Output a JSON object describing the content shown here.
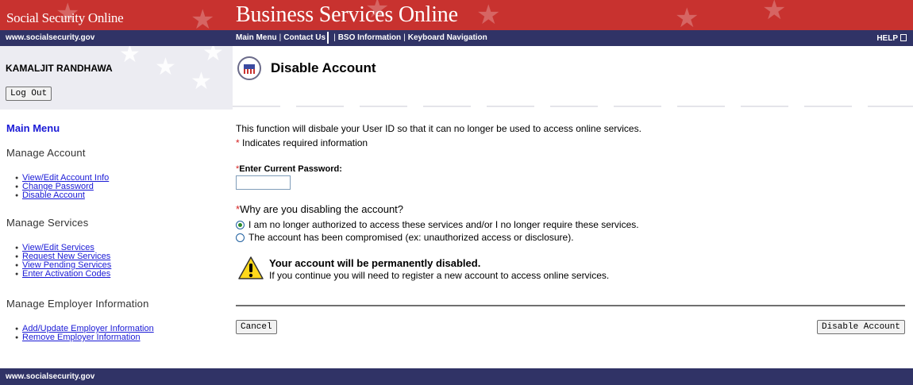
{
  "banner": {
    "site_name": "Social Security Online",
    "app_title": "Business Services Online"
  },
  "navbar": {
    "site_url": "www.socialsecurity.gov",
    "links": {
      "main_menu": "Main Menu",
      "contact_us": "Contact Us",
      "bso_information": "BSO Information",
      "keyboard_navigation": "Keyboard Navigation"
    },
    "separator": "|",
    "help": "HELP"
  },
  "user": {
    "name": "KAMALJIT RANDHAWA",
    "logout_label": "Log Out"
  },
  "page": {
    "title": "Disable Account"
  },
  "sidebar": {
    "main_menu": "Main Menu",
    "sections": [
      {
        "heading": "Manage Account",
        "items": [
          "View/Edit Account Info",
          "Change Password",
          "Disable Account"
        ]
      },
      {
        "heading": "Manage Services",
        "items": [
          "View/Edit Services",
          "Request New Services",
          "View Pending Services",
          "Enter Activation Codes"
        ]
      },
      {
        "heading": "Manage Employer Information",
        "items": [
          "Add/Update Employer Information",
          "Remove Employer Information"
        ]
      }
    ]
  },
  "form": {
    "intro": "This function will disbale your User ID so that it can no longer be used to access online services.",
    "required_star": "*",
    "required_note": " Indicates required information",
    "password_label": "Enter Current Password:",
    "password_value": "",
    "reason_label": "Why are you disabling the account?",
    "reasons": [
      {
        "label": "I am no longer authorized to access these services and/or I no longer require these services.",
        "selected": true
      },
      {
        "label": "The account has been compromised (ex: unauthorized access or disclosure).",
        "selected": false
      }
    ],
    "warning_title": "Your account will be permanently disabled.",
    "warning_text": "If you continue you will need to register a new account to access online services.",
    "cancel_label": "Cancel",
    "disable_label": "Disable Account"
  },
  "footer": {
    "site_url": "www.socialsecurity.gov"
  },
  "colors": {
    "banner_red": "#c8322f",
    "navy_bar": "#303366",
    "link_blue": "#1a1ad6",
    "required_red": "#d42020"
  },
  "icons": {
    "seal": "ssa-seal-icon",
    "warning": "warning-icon",
    "help": "help-icon",
    "window": "new-window-icon"
  }
}
